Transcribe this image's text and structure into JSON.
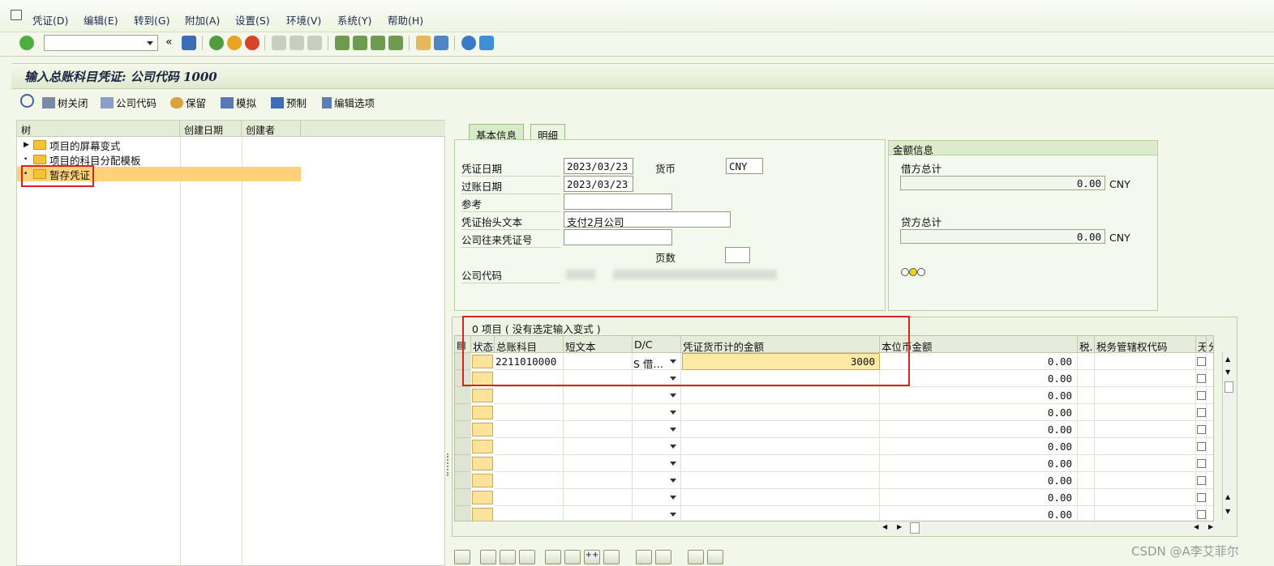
{
  "menu": [
    "凭证(D)",
    "编辑(E)",
    "转到(G)",
    "附加(A)",
    "设置(S)",
    "环境(V)",
    "系统(Y)",
    "帮助(H)"
  ],
  "title": "输入总账科目凭证: 公司代码 1000",
  "app_toolbar": [
    "树关闭",
    "公司代码",
    "保留",
    "模拟",
    "预制",
    "编辑选项"
  ],
  "tree": {
    "columns": [
      "树",
      "创建日期",
      "创建者"
    ],
    "nodes": [
      "项目的屏幕变式",
      "项目的科目分配模板",
      "暂存凭证"
    ]
  },
  "tabs": [
    "基本信息",
    "明细"
  ],
  "basic": {
    "doc_date_label": "凭证日期",
    "doc_date": "2023/03/23",
    "currency_label": "货币",
    "currency": "CNY",
    "post_date_label": "过账日期",
    "post_date": "2023/03/23",
    "ref_label": "参考",
    "ref": "",
    "header_text_label": "凭证抬头文本",
    "header_text": "支付2月公司",
    "inter_co_label": "公司往来凭证号",
    "inter_co": "",
    "pages_label": "页数",
    "pages": "",
    "company_label": "公司代码"
  },
  "amount": {
    "title": "金额信息",
    "debit_label": "借方总计",
    "debit": "0.00",
    "credit_label": "贷方总计",
    "credit": "0.00",
    "currency": "CNY"
  },
  "items": {
    "title": "0 项目 ( 没有选定输入变式 )",
    "columns": [
      "状态",
      "总账科目",
      "短文本",
      "D/C",
      "凭证货币计的金额",
      "本位币金额",
      "税.",
      "税务管辖权代码",
      "无",
      "分配"
    ],
    "row1": {
      "account": "2211010000",
      "short_text": "",
      "dc": "S 借…",
      "amount": "3000",
      "local": "0.00"
    },
    "empty_local": "0.00"
  },
  "watermark": "CSDN @A李艾菲尔"
}
